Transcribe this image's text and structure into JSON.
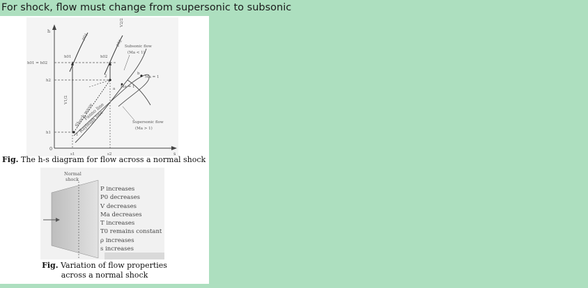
{
  "heading": "For shock, flow must change from supersonic to subsonic",
  "hs_diagram": {
    "caption_fig": "Fig.",
    "caption_text": " The h-s diagram for flow across a normal shock",
    "axis_y": "h",
    "axis_x": "s",
    "origin": "0",
    "label_h01_h02": "h01 = h02",
    "label_h2": "h2",
    "label_h1": "h1",
    "label_s1": "s1",
    "label_s2": "s2",
    "label_h01": "h01",
    "label_h02": "h02",
    "label_p01": "p01",
    "label_p02": "p02",
    "label_v2": "V2/2",
    "label_v1": "V1/2",
    "label_subsonic": "Subsonic flow",
    "label_subsonic_ma": "(Ma < 1)",
    "label_supersonic": "Supersonic flow",
    "label_supersonic_ma": "(Ma > 1)",
    "label_ma1_right": "Ma = 1",
    "label_ma1_inner": "Ma = 1",
    "label_b": "b",
    "label_a": "a",
    "label_2": "2",
    "label_1": "1",
    "label_shock_wave": "Shock wave",
    "label_fanno": "Fanno line",
    "label_rayleigh": "Rayleigh line"
  },
  "shock_diagram": {
    "label_normal": "Normal",
    "label_shock": "shock",
    "properties": [
      "P  increases",
      "P0  decreases",
      "V  decreases",
      "Ma  decreases",
      "T  increases",
      "T0  remains constant",
      "ρ  increases",
      "s  increases"
    ],
    "caption_fig": "Fig.",
    "caption_line1": " Variation of flow properties",
    "caption_line2": "across a normal shock"
  }
}
